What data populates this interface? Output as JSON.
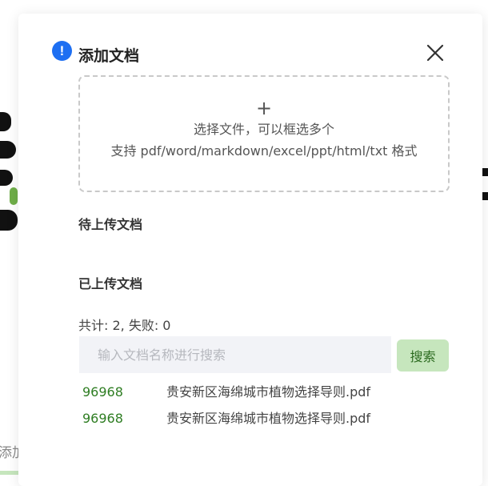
{
  "background": {
    "fragment_text": "添加"
  },
  "modal": {
    "title": "添加文档",
    "info_icon": "exclamation-circle-icon",
    "close_icon": "close-icon",
    "upload": {
      "plus": "+",
      "line1": "选择文件，可以框选多个",
      "line2": "支持 pdf/word/markdown/excel/ppt/html/txt 格式"
    },
    "pending_title": "待上传文档",
    "uploaded_title": "已上传文档",
    "summary": "共计: 2, 失败: 0",
    "search": {
      "placeholder": "输入文档名称进行搜索",
      "value": "",
      "button_label": "搜索"
    },
    "documents": [
      {
        "id": "96968",
        "name": "贵安新区海绵城市植物选择导则.pdf"
      },
      {
        "id": "96968",
        "name": "贵安新区海绵城市植物选择导则.pdf"
      }
    ],
    "colors": {
      "accent_blue": "#1d6ff2",
      "button_bg": "#c6e6bd",
      "button_text": "#2b6a1f",
      "id_green": "#2e7d22"
    }
  }
}
